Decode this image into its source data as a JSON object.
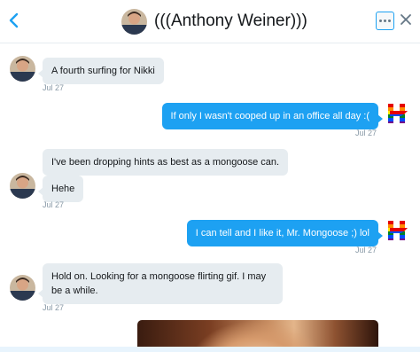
{
  "header": {
    "title": "(((Anthony Weiner)))",
    "back_icon": "chevron-left-icon",
    "more_icon": "more-dots-icon",
    "close_icon": "close-icon"
  },
  "colors": {
    "accent": "#1da1f2",
    "incoming_bubble": "#e6ecf0",
    "timestamp": "#8899a6"
  },
  "messages": [
    {
      "direction": "incoming",
      "text": "A fourth surfing for Nikki",
      "timestamp": "Jul 27"
    },
    {
      "direction": "outgoing",
      "text": "If only I wasn't cooped up in an office all day :(",
      "timestamp": "Jul 27"
    },
    {
      "direction": "incoming",
      "text": "I've been dropping hints as best as a mongoose can."
    },
    {
      "direction": "incoming",
      "text": "Hehe",
      "timestamp": "Jul 27"
    },
    {
      "direction": "outgoing",
      "text": "I can tell and I like it, Mr. Mongoose ;) lol",
      "timestamp": "Jul 27"
    },
    {
      "direction": "incoming",
      "text": "Hold on.  Looking for a mongoose flirting gif.  I may be a while.",
      "timestamp": "Jul 27"
    },
    {
      "direction": "incoming",
      "media": "gif-image"
    }
  ]
}
